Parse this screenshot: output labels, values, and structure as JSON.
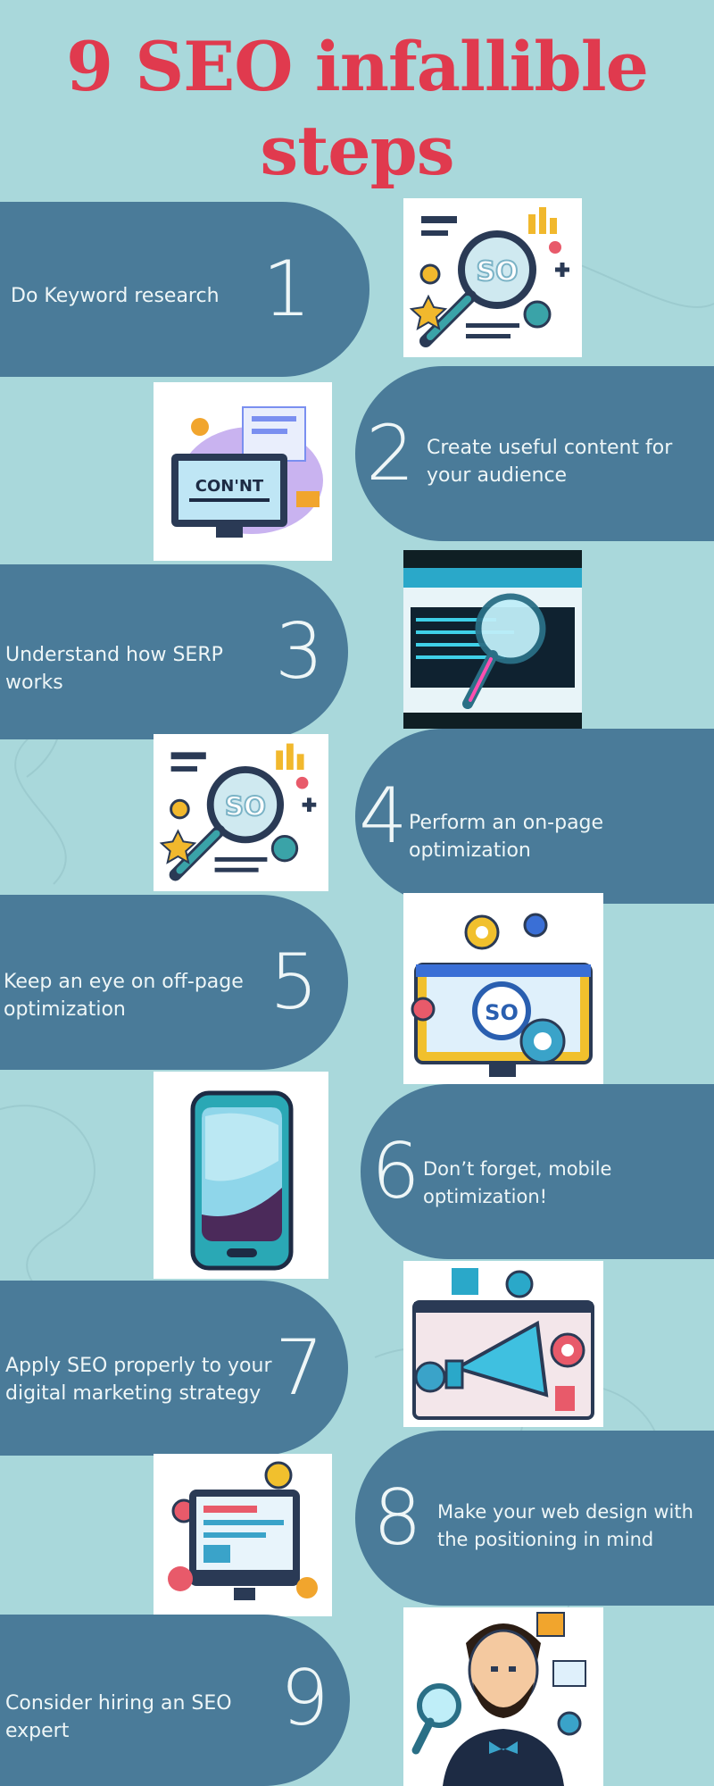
{
  "title": {
    "line1": "9 SEO infallible",
    "line2": "steps"
  },
  "colors": {
    "background": "#a9d8db",
    "pill": "#4a7b99",
    "title": "#e03a4e",
    "text": "#eef6f7"
  },
  "steps": [
    {
      "number": "1",
      "text": "Do Keyword research",
      "icon": "seo-magnifier-doodle-icon"
    },
    {
      "number": "2",
      "text": "Create useful content for your audience",
      "icon": "content-monitor-icon"
    },
    {
      "number": "3",
      "text": "Understand how SERP works",
      "icon": "serp-magnifier-screen-icon"
    },
    {
      "number": "4",
      "text": "Perform an on-page optimization",
      "icon": "seo-magnifier-doodle-icon"
    },
    {
      "number": "5",
      "text": "Keep an eye on off-page optimization",
      "icon": "seo-gears-monitor-icon"
    },
    {
      "number": "6",
      "text": "Don’t forget, mobile optimization!",
      "icon": "smartphone-icon"
    },
    {
      "number": "7",
      "text": "Apply SEO properly to your digital marketing strategy",
      "icon": "megaphone-marketing-icon"
    },
    {
      "number": "8",
      "text": "Make your web design with the positioning in mind",
      "icon": "web-design-monitor-icon"
    },
    {
      "number": "9",
      "text": "Consider hiring an SEO expert",
      "icon": "seo-expert-person-icon"
    }
  ]
}
